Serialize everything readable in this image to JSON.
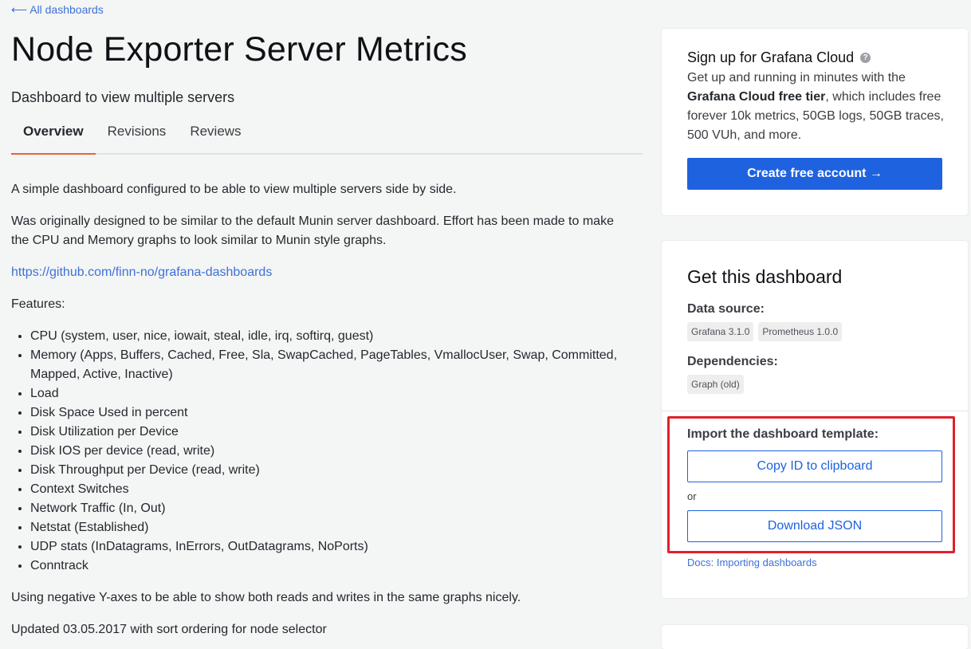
{
  "nav": {
    "back_label": "⟵ All dashboards"
  },
  "page": {
    "title": "Node Exporter Server Metrics",
    "subtitle": "Dashboard to view multiple servers"
  },
  "tabs": [
    {
      "label": "Overview",
      "active": true
    },
    {
      "label": "Revisions",
      "active": false
    },
    {
      "label": "Reviews",
      "active": false
    }
  ],
  "overview": {
    "intro": "A simple dashboard configured to be able to view multiple servers side by side.",
    "history": "Was originally designed to be similar to the default Munin server dashboard. Effort has been made to make the CPU and Memory graphs to look similar to Munin style graphs.",
    "repo_link": "https://github.com/finn-no/grafana-dashboards",
    "features_heading": "Features:",
    "features": [
      "CPU (system, user, nice, iowait, steal, idle, irq, softirq, guest)",
      "Memory (Apps, Buffers, Cached, Free, Sla, SwapCached, PageTables, VmallocUser, Swap, Committed, Mapped, Active, Inactive)",
      "Load",
      "Disk Space Used in percent",
      "Disk Utilization per Device",
      "Disk IOS per device (read, write)",
      "Disk Throughput per Device (read, write)",
      "Context Switches",
      "Network Traffic (In, Out)",
      "Netstat (Established)",
      "UDP stats (InDatagrams, InErrors, OutDatagrams, NoPorts)",
      "Conntrack"
    ],
    "negative_axes": "Using negative Y-axes to be able to show both reads and writes in the same graphs nicely.",
    "updated": "Updated 03.05.2017 with sort ordering for node selector"
  },
  "cloud_card": {
    "title": "Sign up for Grafana Cloud",
    "help_icon": "?",
    "text_before": "Get up and running in minutes with the ",
    "text_bold": "Grafana Cloud free tier",
    "text_after": ", which includes free forever 10k metrics, 50GB logs, 50GB traces, 500 VUh, and more.",
    "button_label": "Create free account →"
  },
  "get_card": {
    "title": "Get this dashboard",
    "data_source_label": "Data source:",
    "data_sources": [
      "Grafana 3.1.0",
      "Prometheus 1.0.0"
    ],
    "dependencies_label": "Dependencies:",
    "dependencies": [
      "Graph (old)"
    ],
    "import_label": "Import the dashboard template:",
    "copy_button": "Copy ID to clipboard",
    "or_text": "or",
    "download_button": "Download JSON",
    "docs_link": "Docs: Importing dashboards"
  },
  "colors": {
    "accent_blue": "#1f62e0",
    "link_blue": "#3d71d9",
    "tab_underline": "#e8633a",
    "highlight_red": "#e0202a"
  }
}
